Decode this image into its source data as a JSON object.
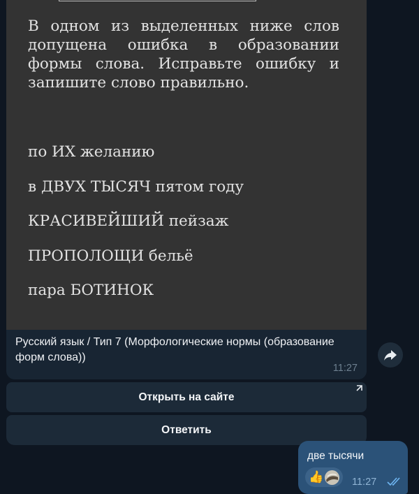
{
  "task": {
    "text": "В одном из выделенных ниже слов допущена ошибка в образовании формы слова. Исправьте ошибку и запишите слово правильно.",
    "phrases": [
      "по ИХ желанию",
      "в ДВУХ ТЫСЯЧ пятом году",
      "КРАСИВЕЙШИЙ пейзаж",
      "ПРОПОЛОЩИ бельё",
      "пара БОТИНОК"
    ]
  },
  "caption": {
    "text": "Русский язык / Тип 7 (Морфологические нормы (образование форм слова))",
    "time": "11:27"
  },
  "buttons": {
    "open_site": "Открыть на сайте",
    "reply": "Ответить"
  },
  "reply": {
    "text": "две тысячи",
    "reaction_emoji": "👍",
    "time": "11:27",
    "status": "read"
  },
  "icons": {
    "share": "share-arrow-icon",
    "external": "external-link-icon",
    "read": "double-check-icon"
  },
  "colors": {
    "background": "#0e1621",
    "incoming_bubble": "#182533",
    "outgoing_bubble": "#2b5278",
    "photo_background": "#333333"
  }
}
